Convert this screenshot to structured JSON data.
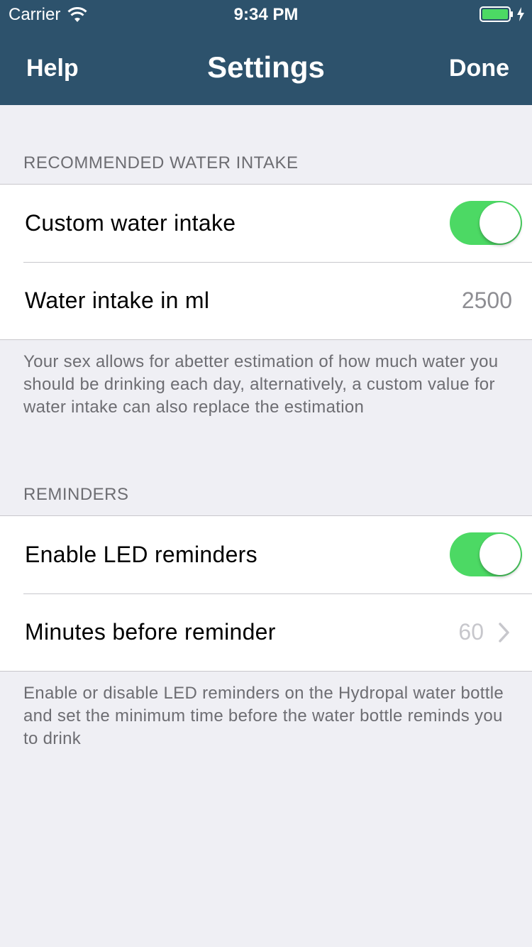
{
  "status_bar": {
    "carrier": "Carrier",
    "time": "9:34 PM",
    "wifi_icon": "wifi-icon",
    "battery_icon": "battery-icon",
    "battery_color": "#4cd964"
  },
  "nav": {
    "left_label": "Help",
    "title": "Settings",
    "right_label": "Done",
    "background": "#2d526c"
  },
  "sections": {
    "water": {
      "header": "RECOMMENDED WATER INTAKE",
      "custom_label": "Custom water intake",
      "custom_enabled": true,
      "intake_label": "Water intake in ml",
      "intake_value": "2500",
      "footer": "Your sex allows for abetter estimation of how much water you should be drinking each day, alternatively, a custom value for water intake can also replace the estimation"
    },
    "reminders": {
      "header": "REMINDERS",
      "led_label": "Enable LED reminders",
      "led_enabled": true,
      "minutes_label": "Minutes before reminder",
      "minutes_value": "60",
      "footer": "Enable or disable LED reminders on the Hydropal water bottle and set the minimum time before the water bottle reminds you to drink"
    }
  },
  "colors": {
    "toggle_on": "#4cd964",
    "background": "#efeff4"
  }
}
